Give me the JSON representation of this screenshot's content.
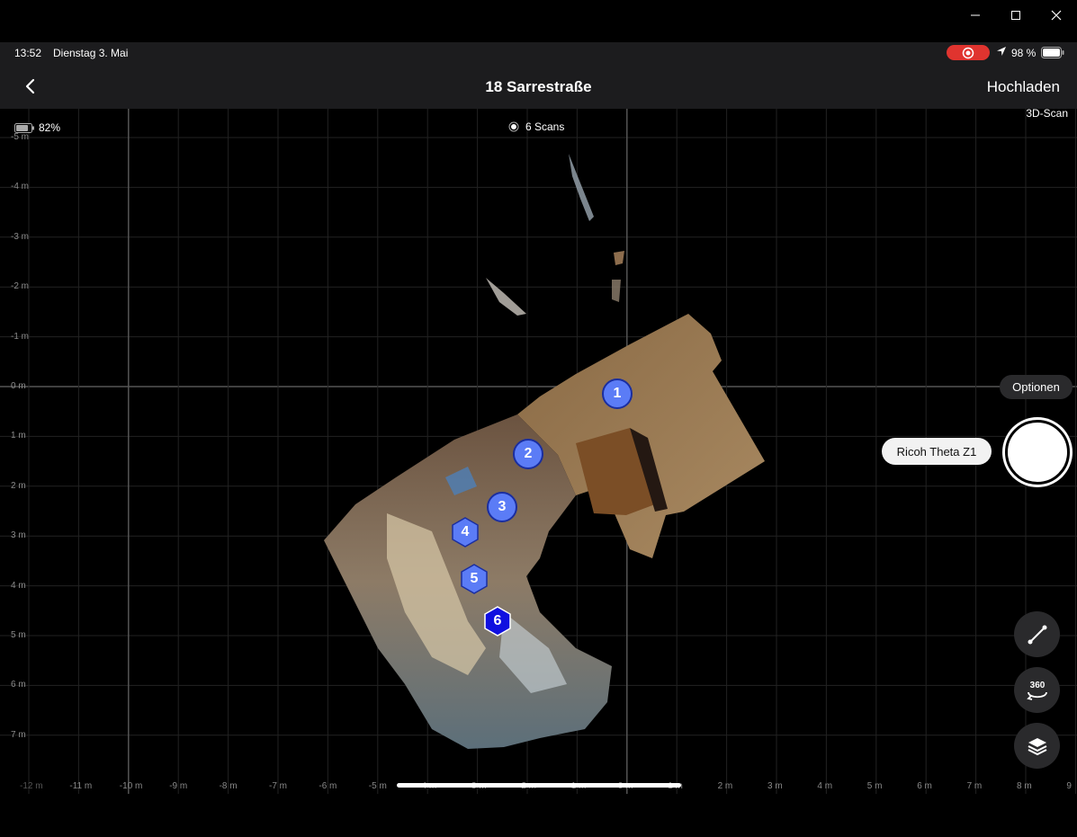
{
  "window": {
    "minimize_icon": "minimize-icon",
    "maximize_icon": "maximize-icon",
    "close_icon": "close-icon"
  },
  "status": {
    "time": "13:52",
    "date": "Dienstag 3. Mai",
    "battery": "98 %",
    "record_color": "#e0342f"
  },
  "nav": {
    "back_icon": "chevron-left-icon",
    "title": "18 Sarrestraße",
    "upload": "Hochladen"
  },
  "map": {
    "device_battery": "82%",
    "scans": "6 Scans",
    "mode": "3D-Scan",
    "y_labels": [
      "-5 m",
      "-4 m",
      "-3 m",
      "-2 m",
      "-1 m",
      "0 m",
      "1 m",
      "2 m",
      "3 m",
      "4 m",
      "5 m",
      "6 m",
      "7 m"
    ],
    "x_labels": [
      "-12 m",
      "-11 m",
      "-10 m",
      "-9 m",
      "-8 m",
      "-7 m",
      "-6 m",
      "-5 m",
      "-4 m",
      "-3 m",
      "-2 m",
      "-1 m",
      "0 m",
      "1 m",
      "2 m",
      "3 m",
      "4 m",
      "5 m",
      "6 m",
      "7 m",
      "8 m",
      "9"
    ],
    "markers": [
      {
        "label": "1",
        "shape": "circle"
      },
      {
        "label": "2",
        "shape": "circle"
      },
      {
        "label": "3",
        "shape": "circle"
      },
      {
        "label": "4",
        "shape": "hexagon"
      },
      {
        "label": "5",
        "shape": "hexagon"
      },
      {
        "label": "6",
        "shape": "hexagon",
        "selected": true
      }
    ],
    "marker_color": "#5b7cf6",
    "selected_marker_color": "#1010e0"
  },
  "controls": {
    "options": "Optionen",
    "camera": "Ricoh Theta Z1",
    "measure_icon": "measure-line-icon",
    "pano_icon": "360-rotate-icon",
    "pano_label": "360",
    "layers_icon": "layers-icon"
  }
}
